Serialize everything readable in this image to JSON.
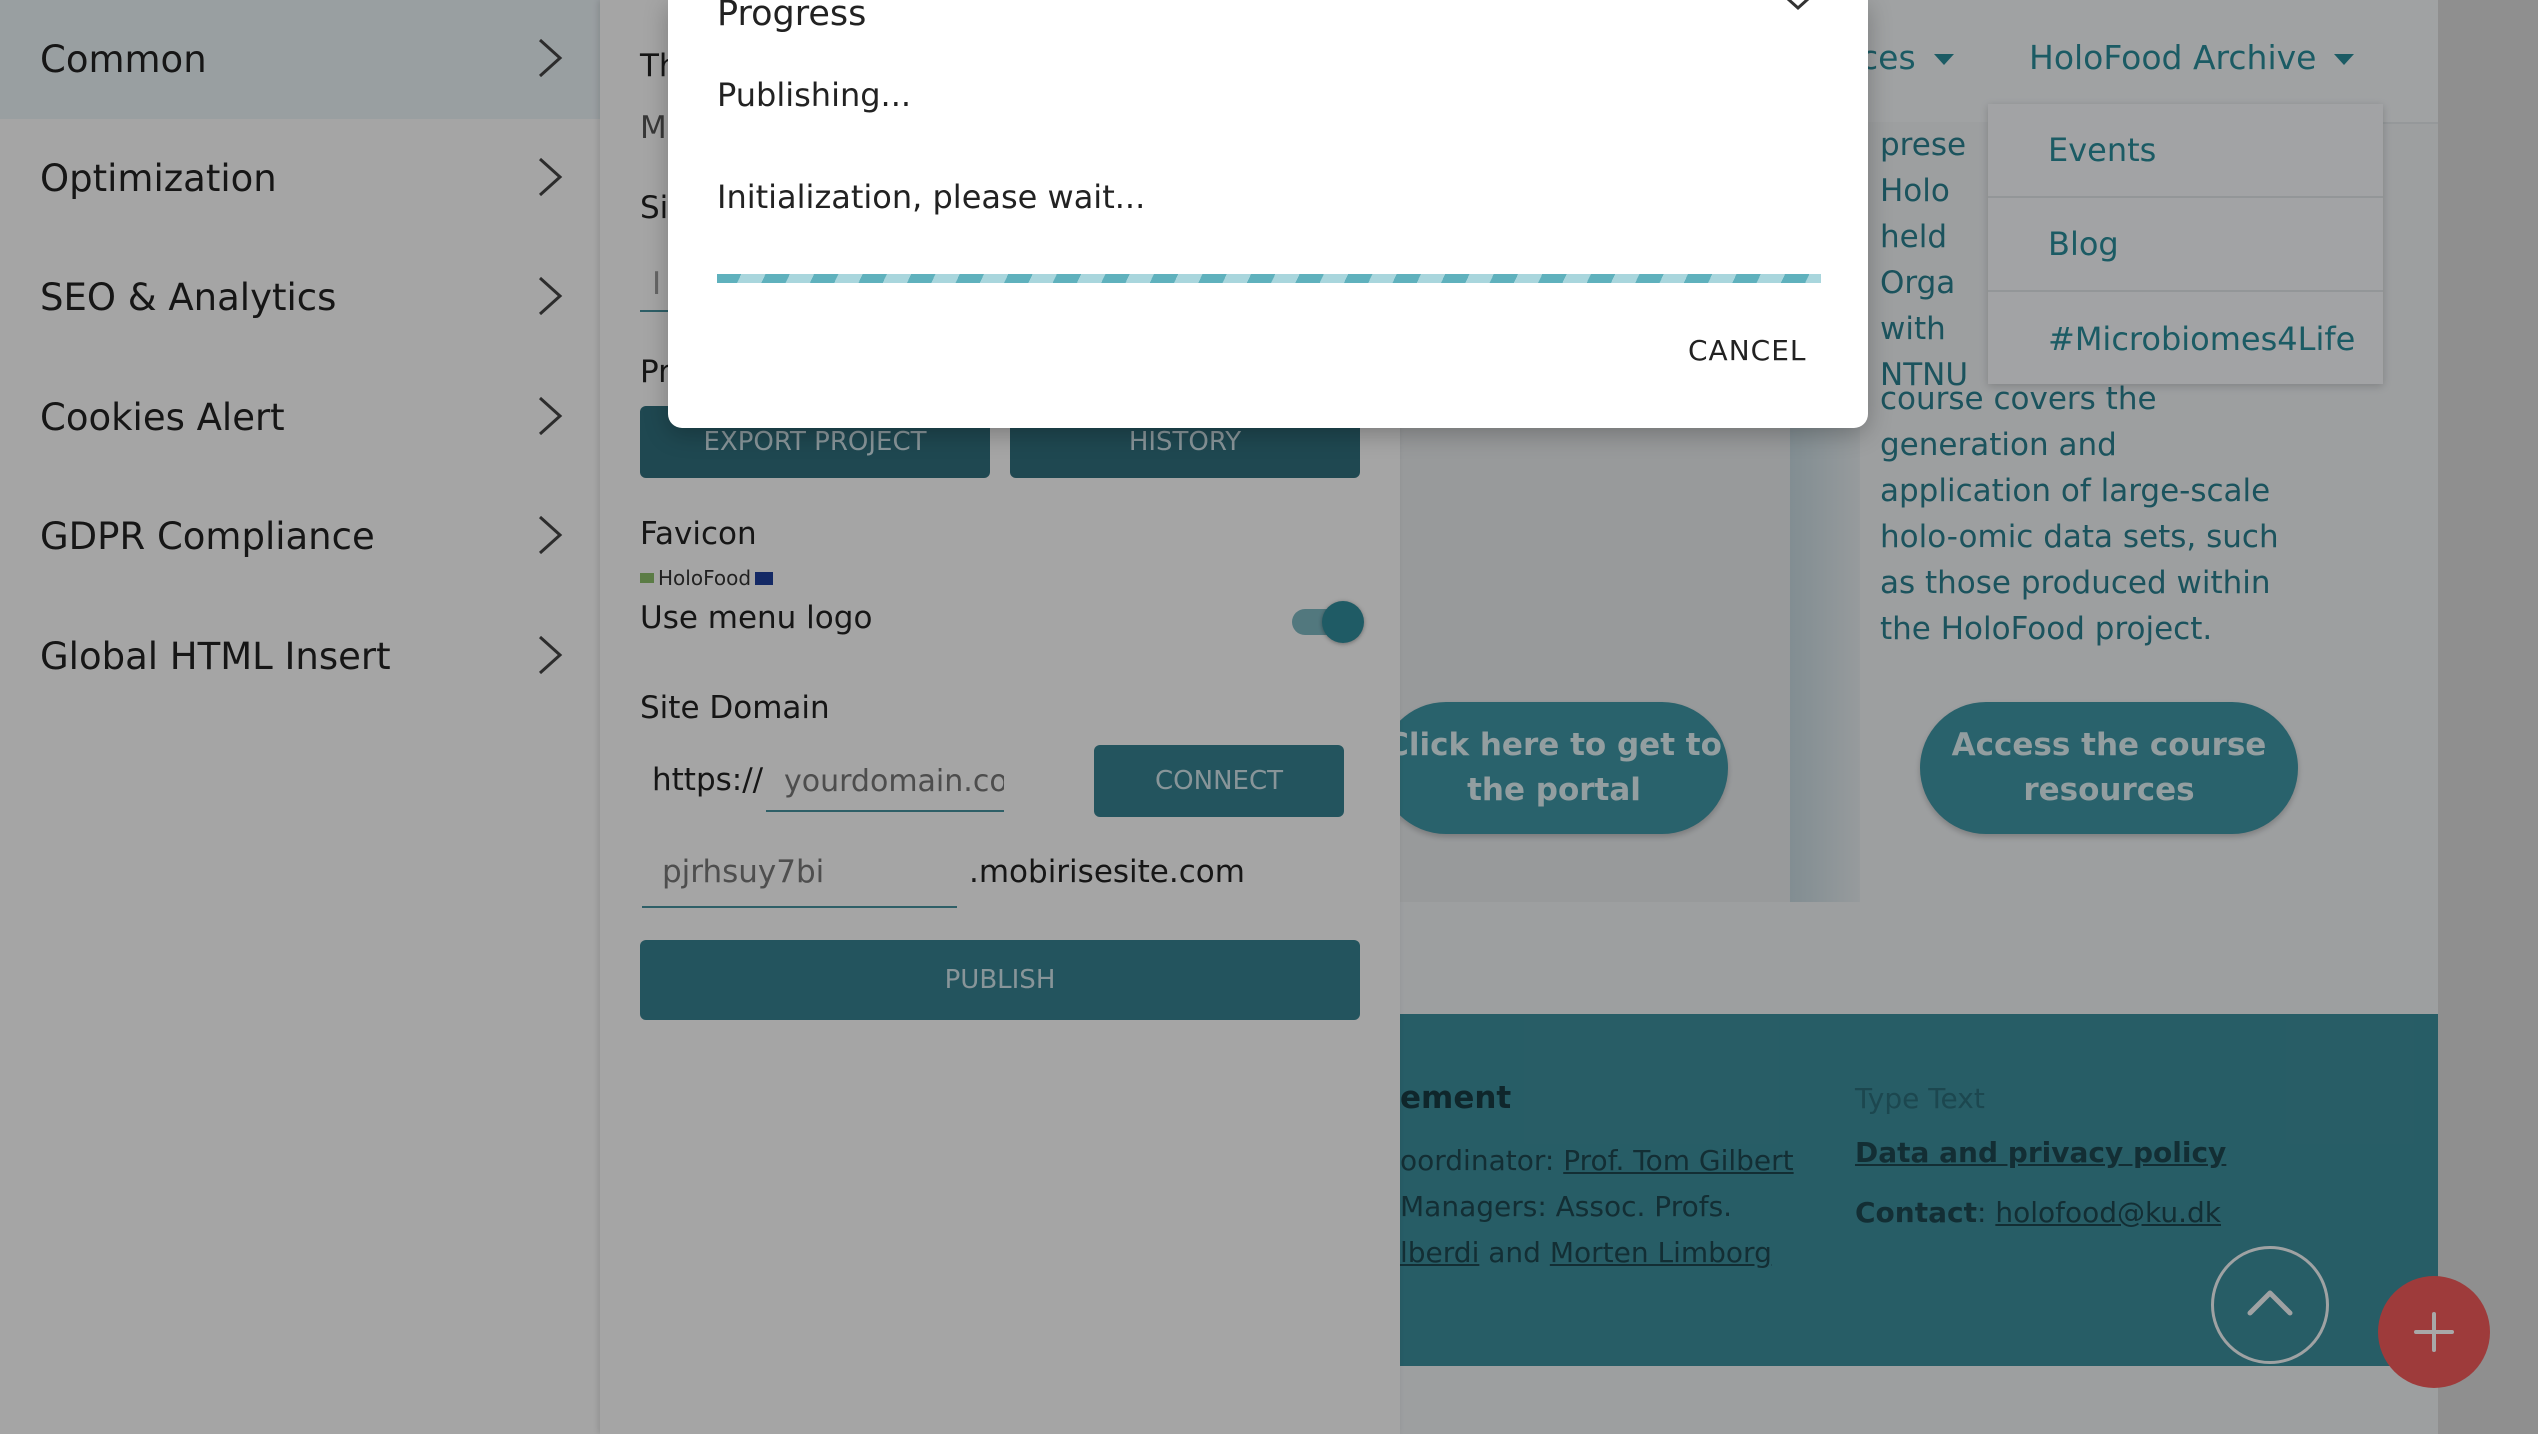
{
  "sidebar": {
    "items": [
      {
        "label": "Common"
      },
      {
        "label": "Optimization"
      },
      {
        "label": "SEO & Analytics"
      },
      {
        "label": "Cookies Alert"
      },
      {
        "label": "GDPR Compliance"
      },
      {
        "label": "Global HTML Insert"
      }
    ]
  },
  "panel": {
    "theme_label_partial": "Th",
    "theme_value_partial": "M",
    "site_label_partial": "Si",
    "site_input_partial": "I",
    "project_label_partial": "Pr",
    "export_button": "EXPORT PROJECT",
    "history_button": "HISTORY",
    "favicon_label": "Favicon",
    "favicon_logo_text": "HoloFood",
    "use_menu_logo_label": "Use menu logo",
    "use_menu_logo_on": true,
    "site_domain_label": "Site Domain",
    "https_prefix": "https://",
    "domain_placeholder": "yourdomain.com",
    "connect_button": "CONNECT",
    "subdomain_value": "pjrhsuy7bi",
    "subdomain_suffix": ".mobirisesite.com",
    "publish_button": "PUBLISH"
  },
  "site": {
    "nav_partial": "ces",
    "nav_archive": "HoloFood Archive",
    "dropdown": [
      {
        "label": "Events"
      },
      {
        "label": "Blog"
      },
      {
        "label": "#Microbiomes4Life"
      }
    ],
    "card_text_partial": [
      "prese",
      "Holo",
      "held",
      "Orga",
      "with",
      "NTNU"
    ],
    "card_text": [
      "course covers the",
      "generation and",
      "application of large-scale",
      "holo-omic data sets, such",
      "as those produced within",
      "the HoloFood project."
    ],
    "portal_button_line1": "Click here to get to",
    "portal_button_line2": "the portal",
    "course_button_line1": "Access the course",
    "course_button_line2": "resources",
    "footer": {
      "heading_partial": "ement",
      "coordinator_prefix": "oordinator: ",
      "coordinator_name": "Prof. Tom Gilbert ",
      "managers_line": " Managers: Assoc. Profs.",
      "manager1_partial": "lberdi",
      "and_word": " and ",
      "manager2": "Morten Limborg",
      "type_text": "Type Text",
      "privacy_link": "Data and privacy policy",
      "contact_label": "Contact",
      "contact_colon": ": ",
      "contact_email": "holofood@ku.dk"
    }
  },
  "modal": {
    "title": "Progress",
    "status": "Publishing...",
    "message": "Initialization, please wait...",
    "cancel_button": "CANCEL"
  },
  "colors": {
    "accent": "#2a8b98",
    "panel_button": "#2f6e7c",
    "fab": "#f05a5a",
    "footer": "#3c8d9b"
  }
}
